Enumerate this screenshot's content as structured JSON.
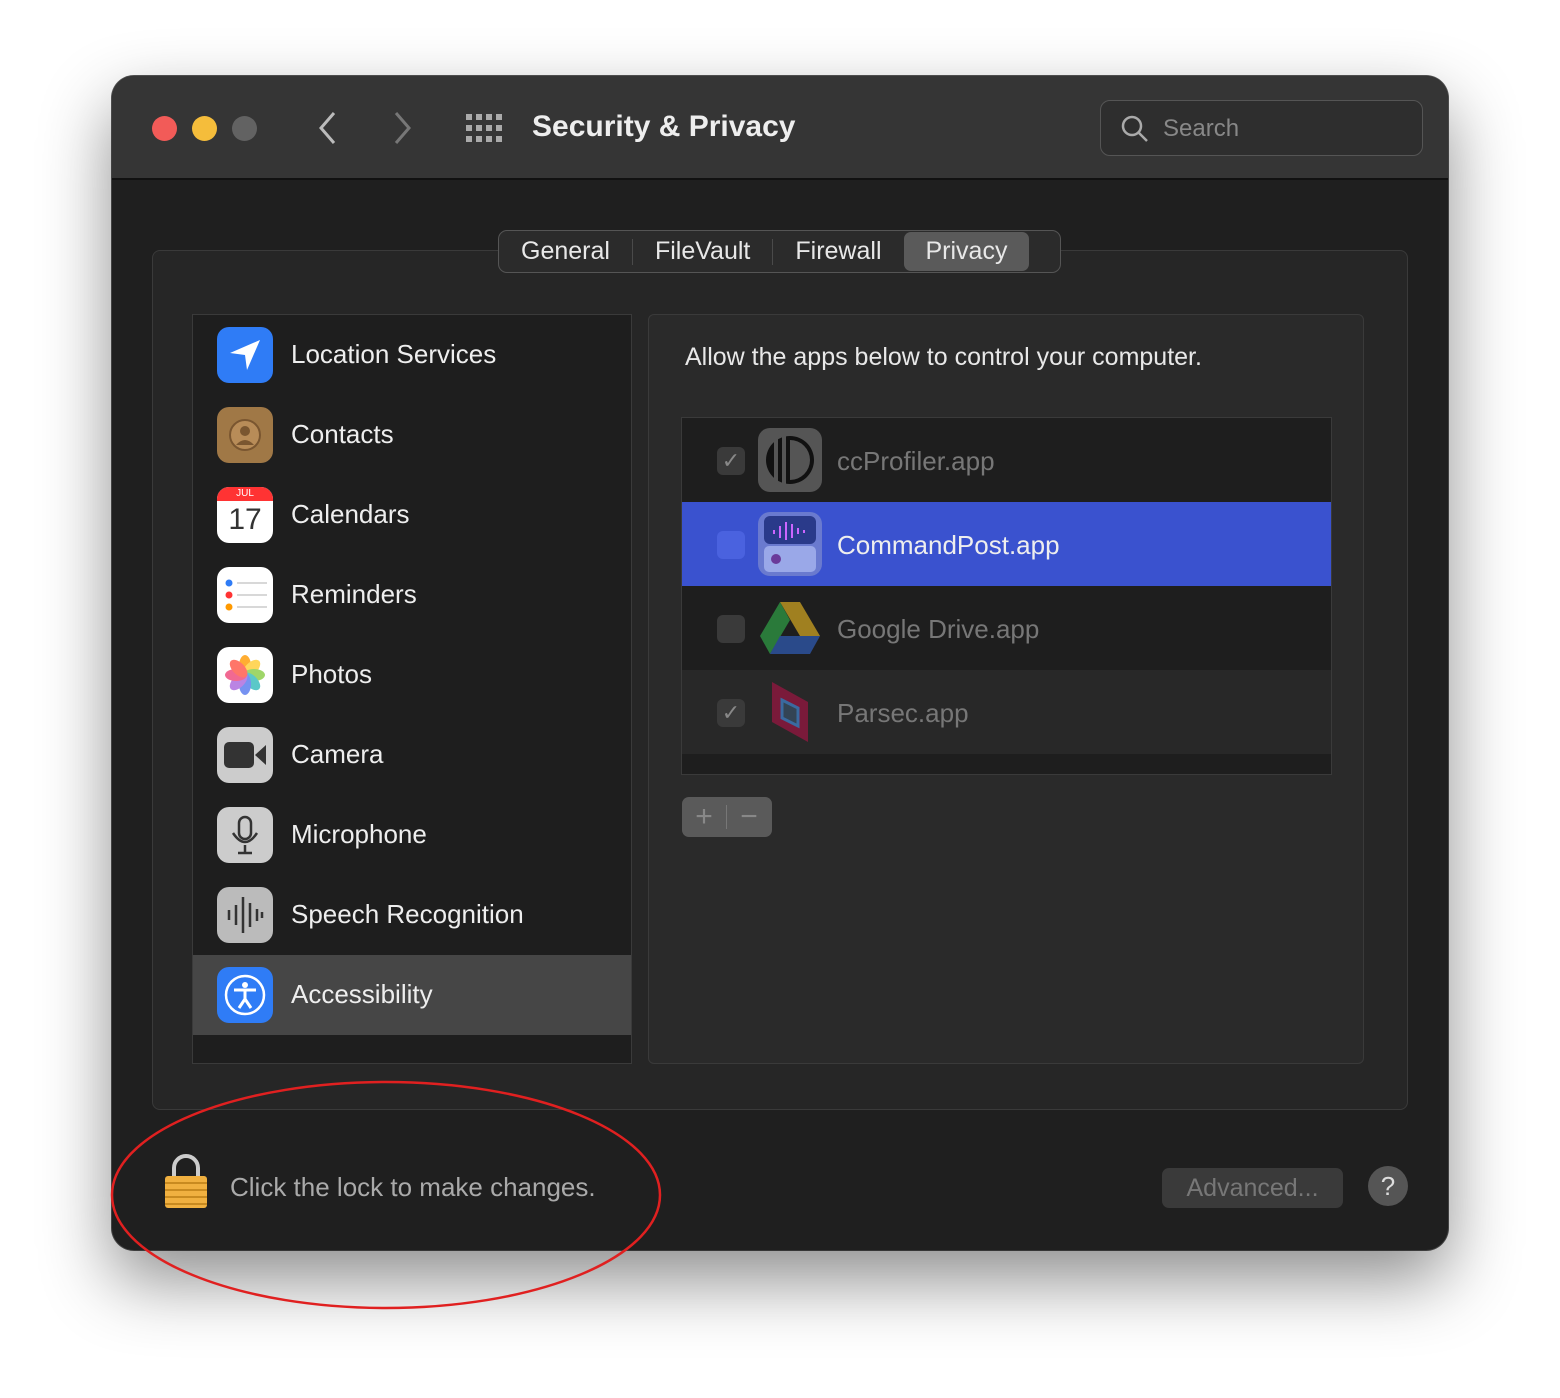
{
  "window": {
    "title": "Security & Privacy",
    "search_placeholder": "Search"
  },
  "tabs": [
    {
      "label": "General"
    },
    {
      "label": "FileVault"
    },
    {
      "label": "Firewall"
    },
    {
      "label": "Privacy",
      "selected": true
    }
  ],
  "sidebar": {
    "items": [
      {
        "label": "Location Services",
        "icon": "location-arrow-icon"
      },
      {
        "label": "Contacts",
        "icon": "contacts-icon"
      },
      {
        "label": "Calendars",
        "icon": "calendar-icon",
        "month": "JUL",
        "day": "17"
      },
      {
        "label": "Reminders",
        "icon": "reminders-icon"
      },
      {
        "label": "Photos",
        "icon": "photos-icon"
      },
      {
        "label": "Camera",
        "icon": "camera-icon"
      },
      {
        "label": "Microphone",
        "icon": "microphone-icon"
      },
      {
        "label": "Speech Recognition",
        "icon": "waveform-icon"
      },
      {
        "label": "Accessibility",
        "icon": "accessibility-icon",
        "selected": true
      }
    ]
  },
  "main": {
    "description": "Allow the apps below to control your computer.",
    "apps": [
      {
        "name": "ccProfiler.app",
        "checked": true
      },
      {
        "name": "CommandPost.app",
        "checked": false,
        "selected": true
      },
      {
        "name": "Google Drive.app",
        "checked": false
      },
      {
        "name": "Parsec.app",
        "checked": true
      }
    ],
    "add_label": "+",
    "remove_label": "−"
  },
  "footer": {
    "lock_text": "Click the lock to make changes.",
    "advanced_label": "Advanced...",
    "help_label": "?"
  },
  "colors": {
    "selection": "#3a52cf",
    "annotation": "#e02020",
    "close": "#f25b58",
    "minimize": "#f5bd3b"
  }
}
